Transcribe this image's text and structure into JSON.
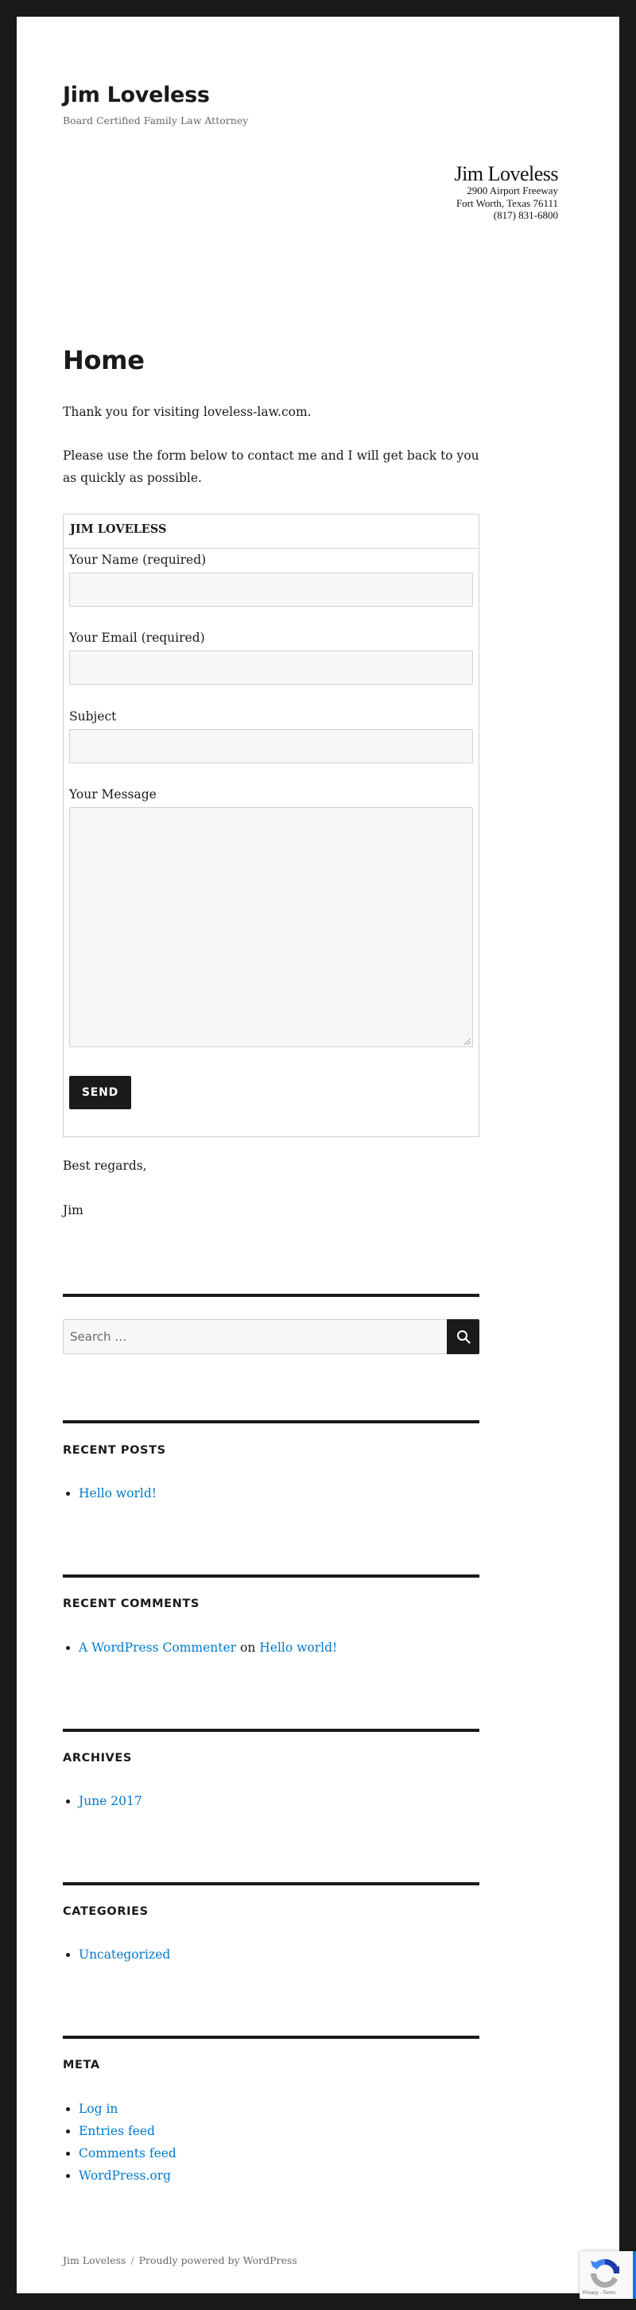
{
  "site": {
    "title": "Jim Loveless",
    "tagline": "Board Certified Family Law Attorney"
  },
  "header_image": {
    "name": "Jim Loveless",
    "address_line1": "2900 Airport Freeway",
    "address_line2": "Fort Worth, Texas 76111",
    "phone": "(817) 831-6800"
  },
  "page": {
    "title": "Home",
    "paragraphs": [
      "Thank you for visiting loveless-law.com.",
      "Please use the form below to contact me and I will get back to you as quickly as possible."
    ],
    "closing": [
      "Best regards,",
      "Jim"
    ]
  },
  "contact_form": {
    "heading": "JIM LOVELESS",
    "fields": [
      {
        "label": "Your Name (required)",
        "value": ""
      },
      {
        "label": "Your Email (required)",
        "value": ""
      },
      {
        "label": "Subject",
        "value": ""
      },
      {
        "label": "Your Message",
        "value": ""
      }
    ],
    "submit_label": "SEND"
  },
  "search": {
    "placeholder": "Search …",
    "icon": "search-icon"
  },
  "widgets": {
    "recent_posts": {
      "title": "Recent Posts",
      "items": [
        "Hello world!"
      ]
    },
    "recent_comments": {
      "title": "Recent Comments",
      "items": [
        {
          "author": "A WordPress Commenter",
          "connector": "on",
          "post": "Hello world!"
        }
      ]
    },
    "archives": {
      "title": "Archives",
      "items": [
        "June 2017"
      ]
    },
    "categories": {
      "title": "Categories",
      "items": [
        "Uncategorized"
      ]
    },
    "meta": {
      "title": "Meta",
      "items": [
        "Log in",
        "Entries feed",
        "Comments feed",
        "WordPress.org"
      ]
    }
  },
  "footer": {
    "site_name": "Jim Loveless",
    "separator": "/",
    "powered_by": "Proudly powered by WordPress"
  },
  "recaptcha": {
    "links": "Privacy - Terms",
    "icon": "recaptcha-logo-icon"
  },
  "colors": {
    "background": "#1a1a1a",
    "link": "#007acc",
    "text": "#1a1a1a",
    "muted": "#686868"
  }
}
